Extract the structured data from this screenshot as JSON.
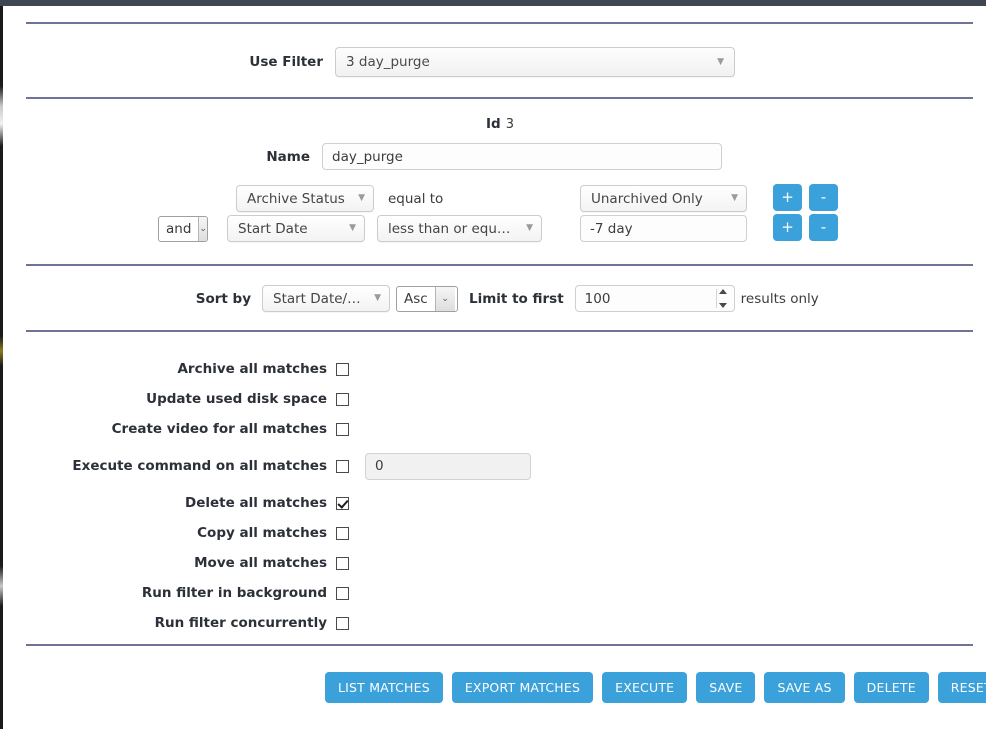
{
  "use_filter": {
    "label": "Use Filter",
    "selected": "3 day_purge"
  },
  "filter": {
    "id_label": "Id",
    "id_value": "3",
    "name_label": "Name",
    "name_value": "day_purge"
  },
  "conditions": [
    {
      "conjunction": null,
      "field": "Archive Status",
      "operator": "equal to",
      "operator_is_dropdown": false,
      "value": "Unarchived Only",
      "value_is_dropdown": true,
      "add_label": "+",
      "remove_label": "-"
    },
    {
      "conjunction": "and",
      "field": "Start Date",
      "operator": "less than or equal to",
      "operator_is_dropdown": true,
      "value": "-7 day",
      "value_is_dropdown": false,
      "add_label": "+",
      "remove_label": "-"
    }
  ],
  "sort": {
    "label": "Sort by",
    "field": "Start Date/Ti...",
    "direction": "Asc",
    "limit_label": "Limit to first",
    "limit_value": "100",
    "results_label": "results only"
  },
  "options": [
    {
      "label": "Archive all matches",
      "checked": false,
      "input": null
    },
    {
      "label": "Update used disk space",
      "checked": false,
      "input": null
    },
    {
      "label": "Create video for all matches",
      "checked": false,
      "input": null
    },
    {
      "label": "Execute command on all matches",
      "checked": false,
      "input": "0"
    },
    {
      "label": "Delete all matches",
      "checked": true,
      "input": null
    },
    {
      "label": "Copy all matches",
      "checked": false,
      "input": null
    },
    {
      "label": "Move all matches",
      "checked": false,
      "input": null
    },
    {
      "label": "Run filter in background",
      "checked": false,
      "input": null
    },
    {
      "label": "Run filter concurrently",
      "checked": false,
      "input": null
    }
  ],
  "actions": [
    {
      "label": "LIST MATCHES"
    },
    {
      "label": "EXPORT MATCHES"
    },
    {
      "label": "EXECUTE"
    },
    {
      "label": "SAVE"
    },
    {
      "label": "SAVE AS"
    },
    {
      "label": "DELETE"
    },
    {
      "label": "RESET"
    }
  ],
  "icons": {
    "caret_down": "▼",
    "chevron_down": "⌄"
  },
  "colors": {
    "accent": "#3ba1db",
    "divider": "#6e7397",
    "top_bar": "#3e4651"
  }
}
